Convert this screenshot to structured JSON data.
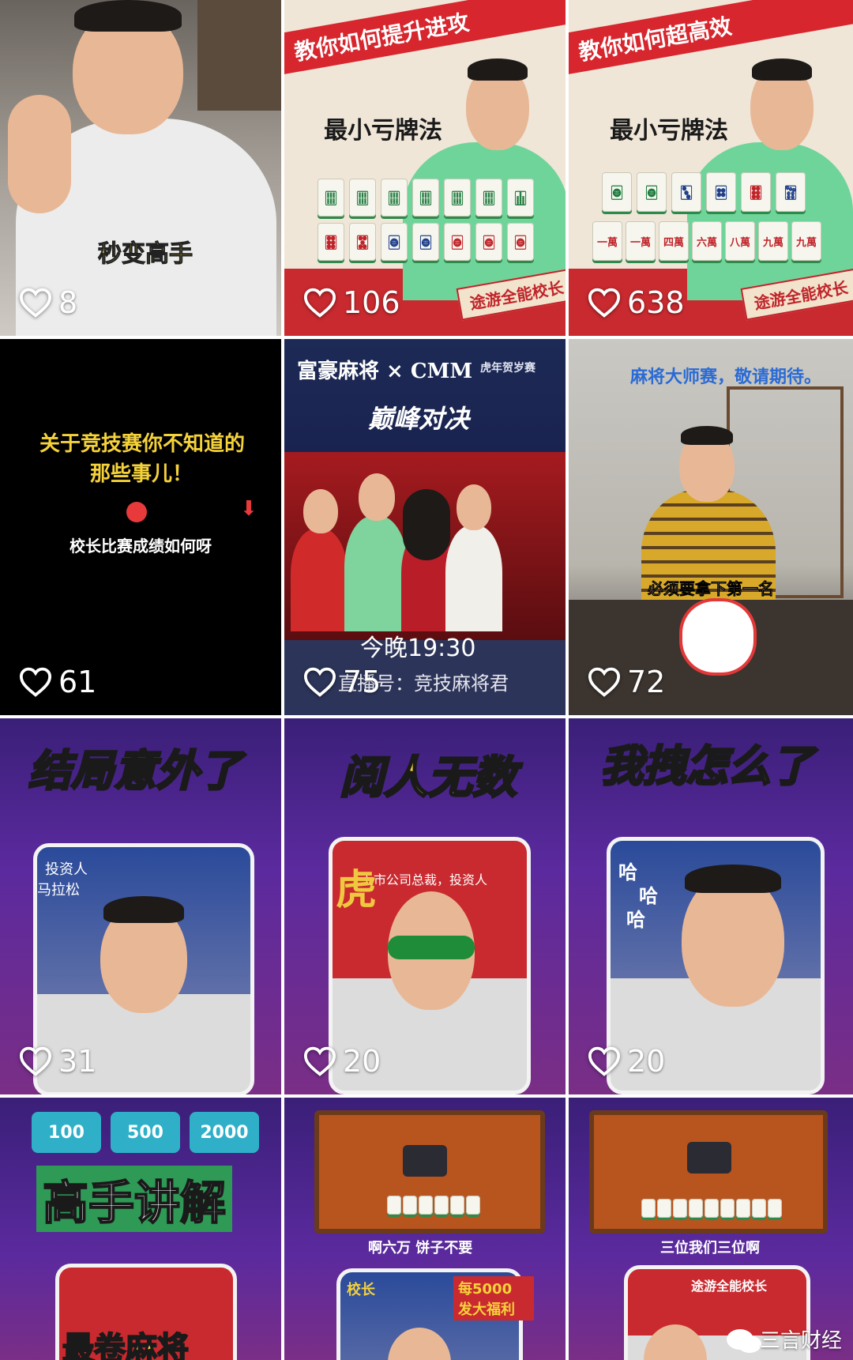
{
  "tiles": [
    {
      "likes": "8",
      "caption": "秒变高手"
    },
    {
      "likes": "106",
      "banner": "教你如何提升进攻",
      "title": "最小亏牌法",
      "ribbon": "途游全能校长",
      "row1": [
        "🀕",
        "🀕",
        "🀕",
        "🀕",
        "🀕",
        "🀕",
        "🀖"
      ],
      "row2": [
        "🀞",
        "🀝",
        "🀙",
        "🀙",
        "🀙",
        "🀙",
        "🀙"
      ]
    },
    {
      "likes": "638",
      "banner": "教你如何超高效",
      "title": "最小亏牌法",
      "ribbon": "途游全能校长",
      "row1": [
        "🀙",
        "🀙",
        "🀛",
        "🀜",
        "🀞",
        "🀟"
      ],
      "row2": [
        "一萬",
        "一萬",
        "四萬",
        "六萬",
        "八萬",
        "九萬",
        "九萬"
      ]
    },
    {
      "likes": "61",
      "line1": "关于竞技赛你不知道的",
      "line2": "那些事儿！",
      "line3": "校长比赛成绩如何呀"
    },
    {
      "likes": "75",
      "brand": "富豪麻将 × CMM",
      "brand_sub": "虎年贺岁赛",
      "title": "巅峰对决",
      "time": "今晚19:30",
      "channel": "直播号：竞技麻将君"
    },
    {
      "likes": "72",
      "top_caption": "麻将大师赛，敬请期待。",
      "caption": "必须要拿下第一名"
    },
    {
      "likes": "31",
      "headline": "结局意外了",
      "frame_label_1": "投资人",
      "frame_label_2": "马拉松"
    },
    {
      "likes": "20",
      "headline": "阅人无数",
      "frame_text": "上市公司总裁，投资人",
      "tiger": "虎"
    },
    {
      "likes": "20",
      "headline": "我拽怎么了",
      "laugh": "哈"
    },
    {
      "scores": [
        "100",
        "500",
        "2000"
      ],
      "headline": "高手讲解",
      "sub": "最卷麻将"
    },
    {
      "caption": "啊六万 饼子不要",
      "banner": "每5000 发大福利",
      "label": "校长"
    },
    {
      "caption": "三位我们三位啊",
      "label": "途游全能校长",
      "watermark": "三言财经"
    }
  ],
  "colors": {
    "heart": "#ffffff",
    "banner_red": "#d7262e",
    "gold": "#f5d23a",
    "purple": "#5b2a9e"
  }
}
